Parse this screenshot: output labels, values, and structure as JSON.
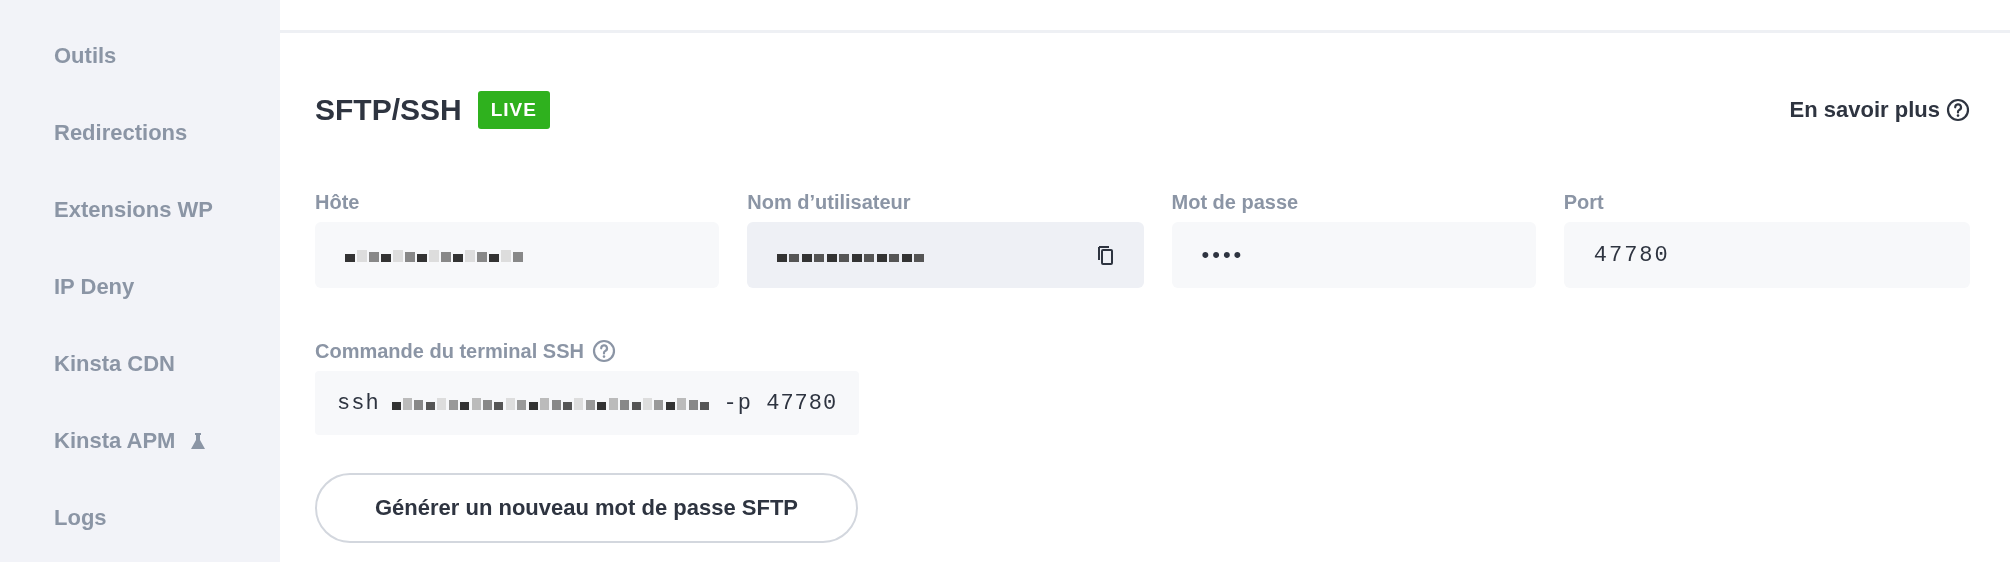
{
  "sidebar": {
    "items": [
      {
        "label": "Outils",
        "kind": "plain"
      },
      {
        "label": "Redirections",
        "kind": "plain"
      },
      {
        "label": "Extensions WP",
        "kind": "plain"
      },
      {
        "label": "IP Deny",
        "kind": "plain"
      },
      {
        "label": "Kinsta CDN",
        "kind": "plain"
      },
      {
        "label": "Kinsta APM",
        "kind": "beta"
      },
      {
        "label": "Logs",
        "kind": "plain"
      }
    ]
  },
  "section": {
    "title": "SFTP/SSH",
    "badge": "LIVE",
    "help_link": "En savoir plus",
    "fields": [
      {
        "label": "Hôte",
        "kind": "redacted",
        "copyable": false
      },
      {
        "label": "Nom d’utilisateur",
        "kind": "redacted",
        "copyable": true
      },
      {
        "label": "Mot de passe",
        "kind": "plain",
        "value": "••••",
        "copyable": false
      },
      {
        "label": "Port",
        "kind": "mono",
        "value": "47780",
        "copyable": false
      }
    ],
    "terminal": {
      "label": "Commande du terminal SSH",
      "prefix": "ssh",
      "suffix": "-p 47780"
    },
    "button": "Générer un nouveau mot de passe SFTP"
  }
}
